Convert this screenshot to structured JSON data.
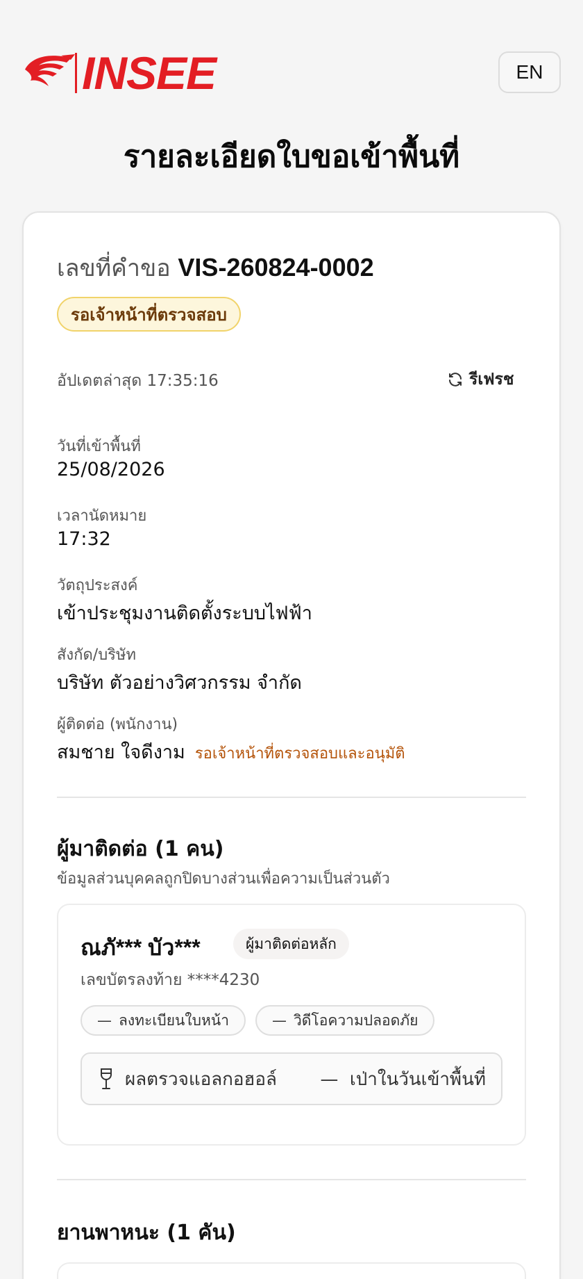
{
  "header": {
    "brand": "INSEE",
    "lang_button": "EN"
  },
  "page_title": "รายละเอียดใบขอเข้าพื้นที่",
  "request": {
    "label": "เลขที่คำขอ",
    "number": "VIS-260824-0002",
    "status": "รอเจ้าหน้าที่ตรวจสอบ",
    "updated_label": "อัปเดตล่าสุด",
    "updated_time": "17:35:16",
    "refresh_label": "รีเฟรช"
  },
  "fields": {
    "entry_date": {
      "label": "วันที่เข้าพื้นที่",
      "value": "25/08/2026"
    },
    "appointment_time": {
      "label": "เวลานัดหมาย",
      "value": "17:32"
    },
    "purpose": {
      "label": "วัตถุประสงค์",
      "value": "เข้าประชุมงานติดตั้งระบบไฟฟ้า"
    },
    "company": {
      "label": "สังกัด/บริษัท",
      "value": "บริษัท ตัวอย่างวิศวกรรม จำกัด"
    },
    "contact": {
      "label": "ผู้ติดต่อ (พนักงาน)",
      "value": "สมชาย ใจดีงาม",
      "note": "รอเจ้าหน้าที่ตรวจสอบและอนุมัติ"
    }
  },
  "visitors": {
    "title": "ผู้มาติดต่อ (1 คน)",
    "subtitle": "ข้อมูลส่วนบุคคลถูกปิดบางส่วนเพื่อความเป็นส่วนตัว",
    "items": [
      {
        "name": "ณภั*** บัว***",
        "badge": "ผู้มาติดต่อหลัก",
        "id_label": "เลขบัตรลงท้าย",
        "id_value": "****4230",
        "chip_register": "ลงทะเบียนใบหน้า",
        "chip_video": "วิดีโอความปลอดภัย",
        "alcohol_label": "ผลตรวจแอลกอฮอล์",
        "alcohol_status": "เป่าในวันเข้าพื้นที่"
      }
    ]
  },
  "vehicles": {
    "title": "ยานพาหนะ (1 คัน)"
  },
  "colors": {
    "brand_red": "#e31e24",
    "status_bg": "#fdf6dc",
    "status_border": "#f1d36a",
    "status_text": "#6b3a0a",
    "note_orange": "#b45309"
  }
}
